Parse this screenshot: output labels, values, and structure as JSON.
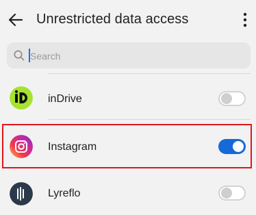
{
  "header": {
    "title": "Unrestricted data access",
    "back_icon": "back-arrow-icon",
    "menu_icon": "more-vertical-icon"
  },
  "search": {
    "placeholder": "Search",
    "icon": "search-icon",
    "value": ""
  },
  "apps": [
    {
      "name": "inDrive",
      "icon": "indrive-icon",
      "toggle_on": false
    },
    {
      "name": "Instagram",
      "icon": "instagram-icon",
      "toggle_on": true,
      "highlighted": true
    },
    {
      "name": "Lyreflo",
      "icon": "lyreflo-icon",
      "toggle_on": false
    }
  ],
  "colors": {
    "accent": "#1669d9",
    "highlight_border": "#e3141c",
    "indrive_green": "#a6e22e"
  }
}
